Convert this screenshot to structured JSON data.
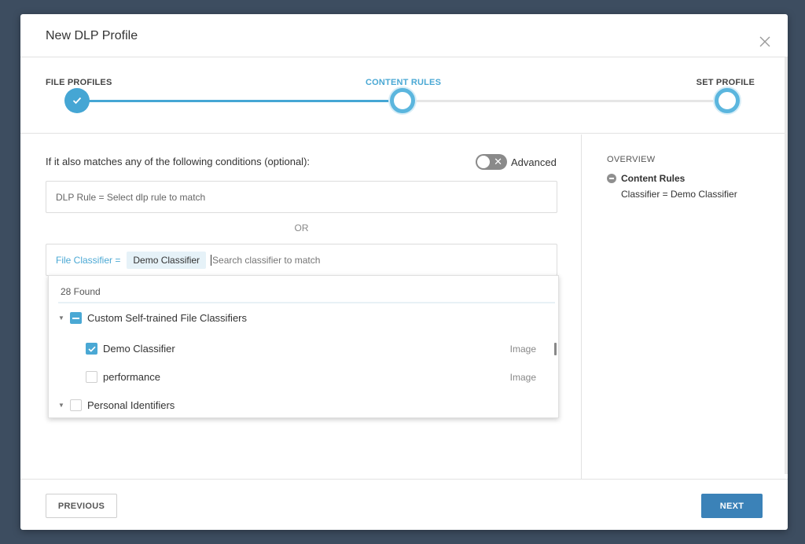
{
  "modal": {
    "title": "New DLP Profile"
  },
  "stepper": {
    "steps": [
      {
        "label": "FILE PROFILES",
        "state": "done"
      },
      {
        "label": "CONTENT RULES",
        "state": "active"
      },
      {
        "label": "SET PROFILE",
        "state": "pending"
      }
    ],
    "progress_color": "#45a6d4"
  },
  "conditions": {
    "prompt": "If it also matches any of the following conditions (optional):",
    "advanced_label": "Advanced",
    "advanced_enabled": false,
    "dlp_rule_placeholder": "DLP Rule = Select dlp rule to match",
    "or_label": "OR",
    "classifier_prefix": "File Classifier =",
    "selected_chip": "Demo Classifier",
    "classifier_search_placeholder": "Search classifier to match"
  },
  "dropdown": {
    "found_text": "28 Found",
    "groups": [
      {
        "label": "Custom Self-trained File Classifiers",
        "state": "partial",
        "items": [
          {
            "label": "Demo Classifier",
            "type": "Image",
            "checked": true
          },
          {
            "label": "performance",
            "type": "Image",
            "checked": false
          }
        ]
      },
      {
        "label": "Personal Identifiers",
        "state": "unchecked",
        "items": []
      }
    ]
  },
  "overview": {
    "title": "OVERVIEW",
    "section_label": "Content Rules",
    "detail": "Classifier = Demo Classifier"
  },
  "footer": {
    "previous_label": "PREVIOUS",
    "next_label": "NEXT"
  },
  "colors": {
    "accent": "#4aa8d4",
    "primary_button": "#3b82b8",
    "backdrop": "#3d4d60"
  }
}
